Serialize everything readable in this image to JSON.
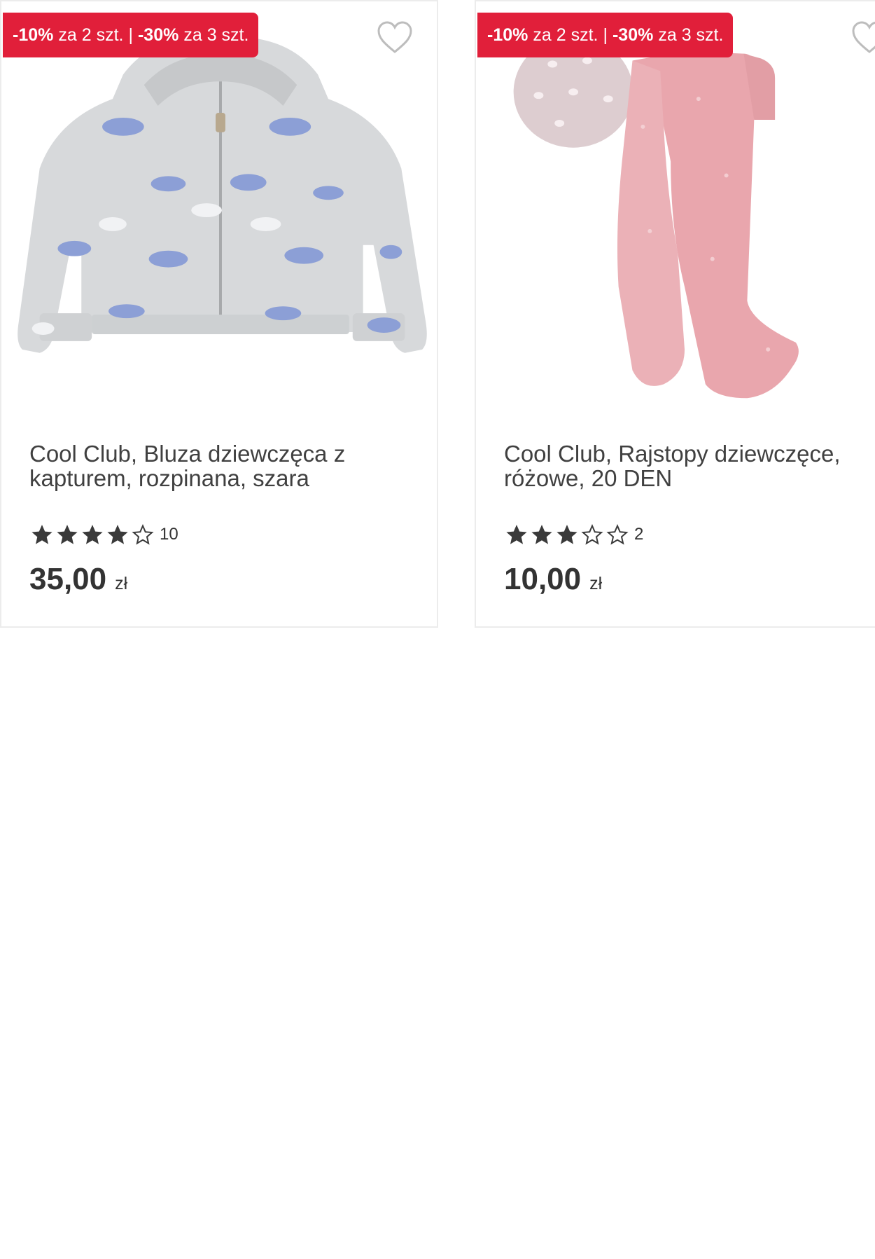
{
  "colors": {
    "badge": "#e11f3a",
    "star": "#3a3a3a",
    "border": "#ececec"
  },
  "products": [
    {
      "badge": {
        "pct1": "-10%",
        "text1": "za 2 szt.",
        "sep": "|",
        "pct2": "-30%",
        "text2": "za 3 szt."
      },
      "name": "Cool Club, Bluza dziewczęca z kapturem, rozpinana, szara",
      "rating": 4,
      "max_rating": 5,
      "review_count": "10",
      "price": "35,00",
      "currency": "zł",
      "image_icon": "hoodie-image",
      "favorite_icon": "heart-icon"
    },
    {
      "badge": {
        "pct1": "-10%",
        "text1": "za 2 szt.",
        "sep": "|",
        "pct2": "-30%",
        "text2": "za 3 szt."
      },
      "name": "Cool Club, Rajstopy dziewczęce, różowe, 20 DEN",
      "rating": 3,
      "max_rating": 5,
      "review_count": "2",
      "price": "10,00",
      "currency": "zł",
      "image_icon": "tights-image",
      "favorite_icon": "heart-icon"
    }
  ]
}
